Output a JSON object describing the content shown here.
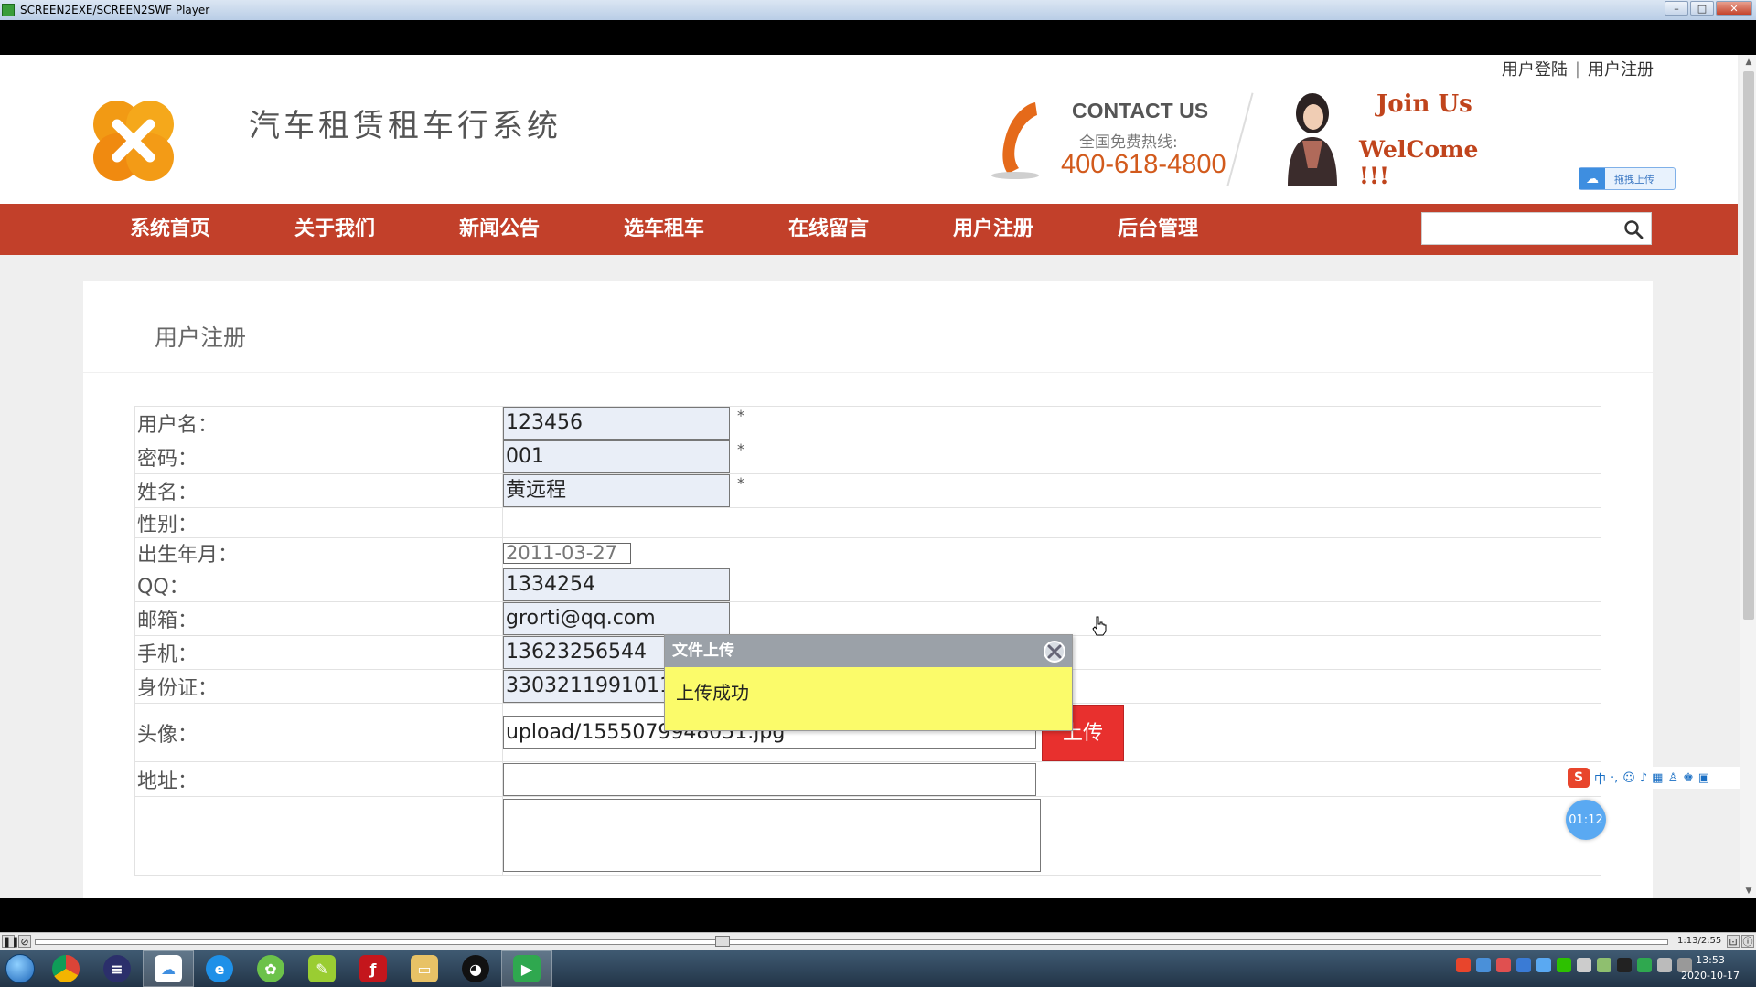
{
  "window": {
    "title": "SCREEN2EXE/SCREEN2SWF Player"
  },
  "header": {
    "login_link": "用户登陆",
    "register_link": "用户注册",
    "site_title": "汽车租赁租车行系统",
    "contact_title": "CONTACT US",
    "contact_sub": "全国免费热线:",
    "contact_phone": "400-618-4800",
    "join_line1": "Join Us",
    "join_line2": "WelCome !!!",
    "upload_pill_label": "拖拽上传"
  },
  "nav": {
    "items": [
      {
        "label": "系统首页"
      },
      {
        "label": "关于我们"
      },
      {
        "label": "新闻公告"
      },
      {
        "label": "选车租车"
      },
      {
        "label": "在线留言"
      },
      {
        "label": "用户注册"
      },
      {
        "label": "后台管理"
      }
    ],
    "search_placeholder": ""
  },
  "form": {
    "heading": "用户注册",
    "fields": [
      {
        "label": "用户名：",
        "value": "123456",
        "required": "*"
      },
      {
        "label": "密码：",
        "value": "001",
        "required": "*"
      },
      {
        "label": "姓名：",
        "value": "黄远程",
        "required": "*"
      },
      {
        "label": "性别：",
        "value": ""
      },
      {
        "label": "出生年月：",
        "value": "2011-03-27"
      },
      {
        "label": "QQ：",
        "value": "1334254"
      },
      {
        "label": "邮箱：",
        "value": "grorti@qq.com"
      },
      {
        "label": "手机：",
        "value": "13623256544"
      },
      {
        "label": "身份证：",
        "value": "3303211991011"
      },
      {
        "label": "头像：",
        "value": "upload/1555079948051.jpg",
        "button": "上传"
      },
      {
        "label": "地址：",
        "value": ""
      }
    ]
  },
  "dialog": {
    "title": "文件上传",
    "message": "上传成功"
  },
  "ime": {
    "s": "S",
    "mode": "中"
  },
  "timer": "01:12",
  "player": {
    "time": "1:13/2:55"
  },
  "clock": {
    "time": "13:53",
    "date": "2020-10-17"
  },
  "colors": {
    "nav_bg": "#c2402a",
    "upload_button": "#e8302e",
    "dialog_body": "#fbfb6a",
    "accent_orange": "#d25a1c"
  }
}
